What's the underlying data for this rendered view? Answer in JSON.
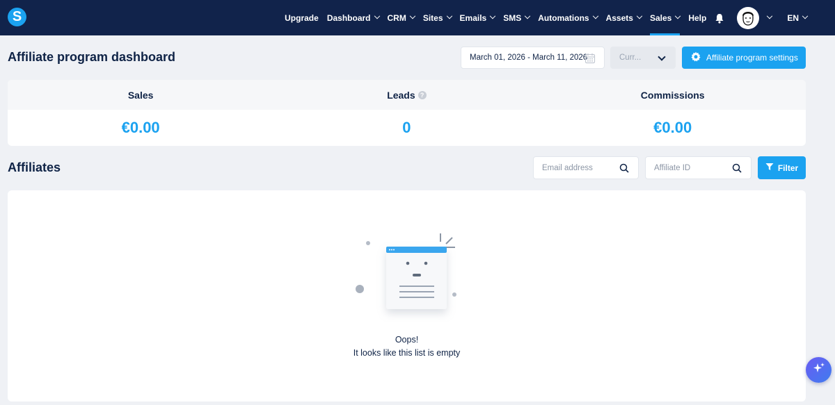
{
  "brand": {
    "logo_letter": "S",
    "accent": "#1ba2f0",
    "nav_bg": "#11234b"
  },
  "nav": {
    "items": [
      {
        "label": "Upgrade",
        "dropdown": false
      },
      {
        "label": "Dashboard",
        "dropdown": true
      },
      {
        "label": "CRM",
        "dropdown": true
      },
      {
        "label": "Sites",
        "dropdown": true
      },
      {
        "label": "Emails",
        "dropdown": true
      },
      {
        "label": "SMS",
        "dropdown": true
      },
      {
        "label": "Automations",
        "dropdown": true
      },
      {
        "label": "Assets",
        "dropdown": true
      },
      {
        "label": "Sales",
        "dropdown": true,
        "active": true
      },
      {
        "label": "Help",
        "dropdown": false
      }
    ],
    "bell_icon": "bell-icon",
    "language": "EN"
  },
  "header": {
    "title": "Affiliate program dashboard",
    "date_range": "March 01, 2026 - March 11, 2026",
    "currency_placeholder": "Curr...",
    "settings_label": "Affiliate program settings"
  },
  "stats": {
    "sales_label": "Sales",
    "sales_value": "€0.00",
    "leads_label": "Leads",
    "leads_help": "?",
    "leads_value": "0",
    "commissions_label": "Commissions",
    "commissions_value": "€0.00"
  },
  "affiliates": {
    "title": "Affiliates",
    "email_placeholder": "Email address",
    "affiliate_id_placeholder": "Affiliate ID",
    "filter_label": "Filter",
    "empty_line1": "Oops!",
    "empty_line2": "It looks like this list is empty"
  }
}
